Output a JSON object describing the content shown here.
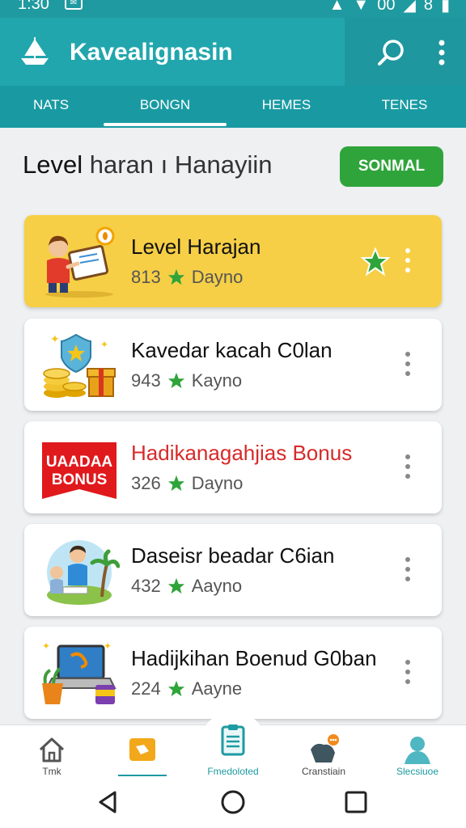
{
  "status_bar": {
    "time": "1:30",
    "right_text": "00",
    "battery": "8"
  },
  "app_bar": {
    "title": "Kavealignasin",
    "logo_icon": "sailboat-icon",
    "search_icon": "search-icon",
    "more_icon": "more-vert-icon"
  },
  "tabs": [
    {
      "label": "NATS",
      "active": false
    },
    {
      "label": "BONGN",
      "active": true
    },
    {
      "label": "HEMES",
      "active": false
    },
    {
      "label": "TENES",
      "active": false
    }
  ],
  "heading": {
    "bold": "Level",
    "rest": "haran ı Hanayiin"
  },
  "action_button": {
    "label": "SONMAL",
    "color": "#2fa43a"
  },
  "cards": [
    {
      "title": "Level Harajan",
      "count": "813",
      "unit": "Dayno",
      "highlight": true,
      "favorite": true,
      "thumb": "teacher-board-icon"
    },
    {
      "title": "Kavedar kacah C0lan",
      "count": "943",
      "unit": "Kayno",
      "highlight": false,
      "favorite": false,
      "thumb": "coins-shield-icon"
    },
    {
      "title": "Hadikanagahjias Bonus",
      "count": "326",
      "unit": "Dayno",
      "highlight": false,
      "favorite": false,
      "thumb": "bonus-banner-icon",
      "banner_line1": "UAADAA",
      "banner_line2": "BONUS"
    },
    {
      "title": "Daseisr beadar C6ian",
      "count": "432",
      "unit": "Aayno",
      "highlight": false,
      "favorite": false,
      "thumb": "family-island-icon"
    },
    {
      "title": "Hadijkihan Boenud G0ban",
      "count": "224",
      "unit": "Aayne",
      "highlight": false,
      "favorite": false,
      "thumb": "laptop-gifts-icon"
    }
  ],
  "bottom_nav": [
    {
      "label": "Tmk",
      "icon": "home-icon",
      "active": false
    },
    {
      "label": "",
      "icon": "offers-icon",
      "active": true
    },
    {
      "label": "Fmedoloted",
      "icon": "clipboard-icon",
      "active": false
    },
    {
      "label": "Cranstiain",
      "icon": "people-chat-icon",
      "active": false
    },
    {
      "label": "Slecsiuoe",
      "icon": "profile-icon",
      "active": false
    }
  ],
  "system_nav": [
    "back-icon",
    "home-circle-icon",
    "recents-icon"
  ],
  "colors": {
    "primary": "#22a6ad",
    "tab_bar": "#199aa2",
    "highlight_card": "#f6cf46",
    "star_green": "#2fa43a",
    "bonus_red": "#d72a2a"
  }
}
